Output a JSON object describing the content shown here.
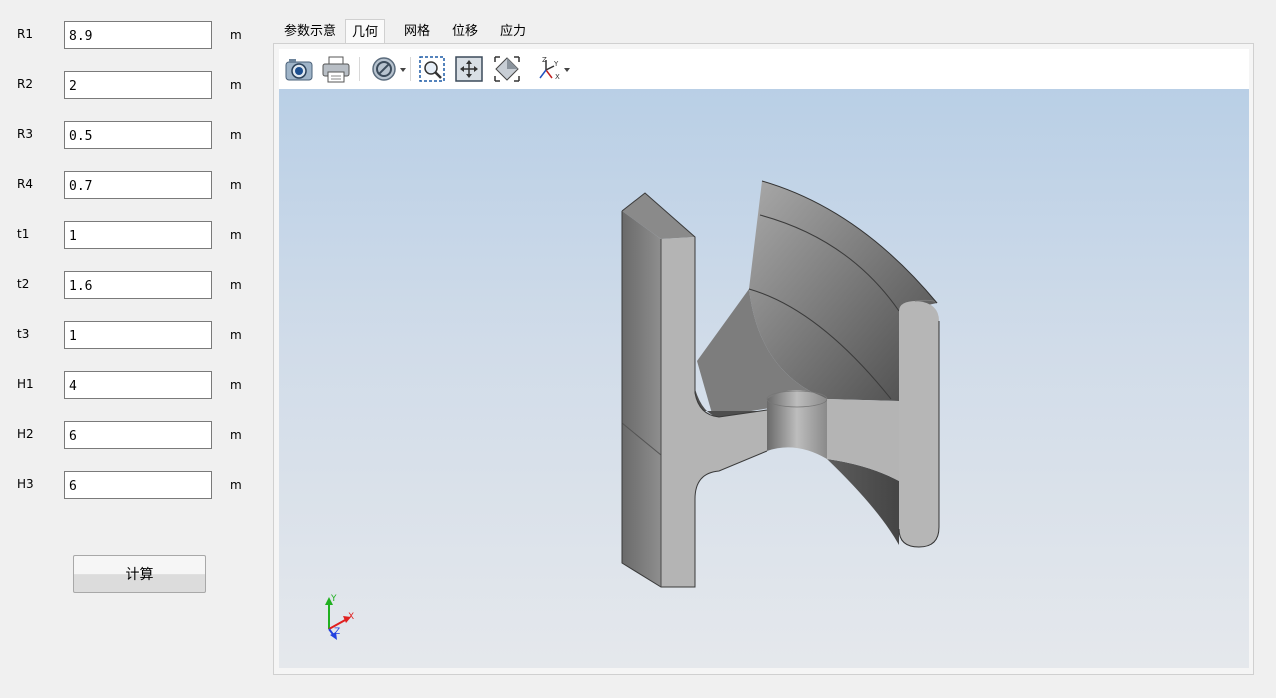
{
  "params": [
    {
      "label": "R1",
      "value": "8.9",
      "unit": "m"
    },
    {
      "label": "R2",
      "value": "2",
      "unit": "m"
    },
    {
      "label": "R3",
      "value": "0.5",
      "unit": "m"
    },
    {
      "label": "R4",
      "value": "0.7",
      "unit": "m"
    },
    {
      "label": "t1",
      "value": "1",
      "unit": "m"
    },
    {
      "label": "t2",
      "value": "1.6",
      "unit": "m"
    },
    {
      "label": "t3",
      "value": "1",
      "unit": "m"
    },
    {
      "label": "H1",
      "value": "4",
      "unit": "m"
    },
    {
      "label": "H2",
      "value": "6",
      "unit": "m"
    },
    {
      "label": "H3",
      "value": "6",
      "unit": "m"
    }
  ],
  "calc_button": "计算",
  "tabs": [
    {
      "label": "参数示意",
      "active": false
    },
    {
      "label": "几何",
      "active": true
    },
    {
      "label": "网格",
      "active": false
    },
    {
      "label": "位移",
      "active": false
    },
    {
      "label": "应力",
      "active": false
    }
  ],
  "toolbar": [
    {
      "icon": "camera-icon"
    },
    {
      "icon": "printer-icon"
    },
    {
      "icon": "clipping-plane-icon"
    },
    {
      "icon": "zoom-box-icon"
    },
    {
      "icon": "fit-all-icon"
    },
    {
      "icon": "isometric-view-icon"
    },
    {
      "icon": "axis-view-icon"
    }
  ],
  "triad": {
    "x": "X",
    "y": "Y",
    "z": "Z",
    "x_color": "#e02020",
    "y_color": "#20b020",
    "z_color": "#2040e0"
  },
  "colors": {
    "viewport_top": "#b9cfe6",
    "viewport_bottom": "#e5e8ec",
    "model_face": "#b4b4b4"
  }
}
